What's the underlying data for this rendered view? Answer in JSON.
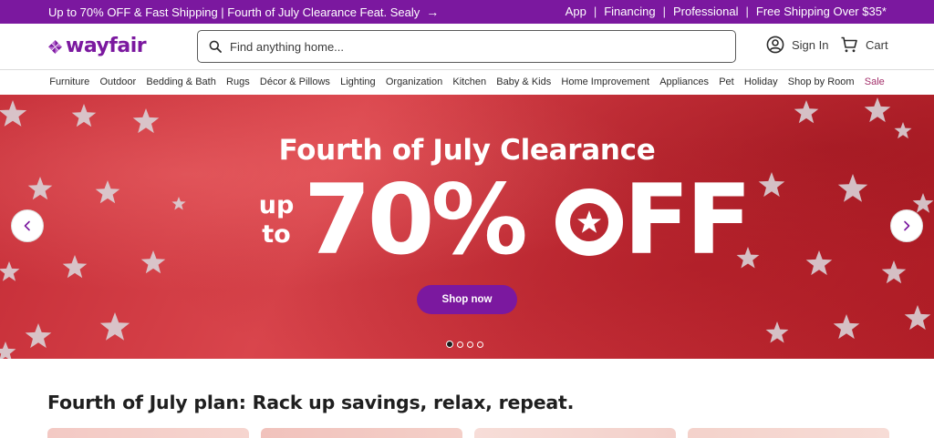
{
  "promo": {
    "left_text": "Up to 70% OFF & Fast Shipping | Fourth of July Clearance Feat. Sealy",
    "arrow_icon": "arrow-right-icon",
    "right_links": [
      "App",
      "Financing",
      "Professional",
      "Free Shipping Over $35*"
    ]
  },
  "header": {
    "logo_text": "wayfair",
    "search_placeholder": "Find anything home...",
    "signin_label": "Sign In",
    "cart_label": "Cart"
  },
  "nav": {
    "items": [
      "Furniture",
      "Outdoor",
      "Bedding & Bath",
      "Rugs",
      "Décor & Pillows",
      "Lighting",
      "Organization",
      "Kitchen",
      "Baby & Kids",
      "Home Improvement",
      "Appliances",
      "Pet",
      "Holiday",
      "Shop by Room",
      "Sale"
    ]
  },
  "hero": {
    "title": "Fourth of July Clearance",
    "upto_line1": "up",
    "upto_line2": "to",
    "big_a": "70% ",
    "big_b": "FF",
    "cta": "Shop now",
    "slide_count": 4,
    "active_slide": 1
  },
  "section": {
    "title": "Fourth of July plan: Rack up savings, relax, repeat."
  },
  "colors": {
    "brand": "#7b189f",
    "hero_red": "#c8323b",
    "sale": "#a32f6a"
  }
}
